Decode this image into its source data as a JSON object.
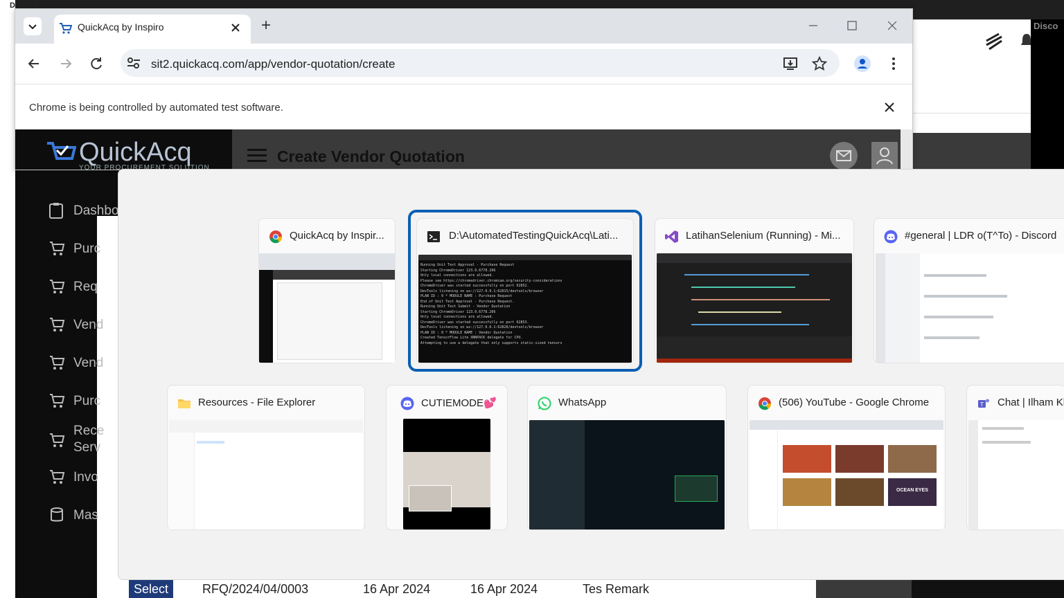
{
  "background": {
    "discord_label": "Discord",
    "right_window_label": "Disco"
  },
  "browser": {
    "tab_title": "QuickAcq by Inspiro",
    "new_tab_label": "+",
    "url": "sit2.quickacq.com/app/vendor-quotation/create",
    "infobar_text": "Chrome is being controlled by automated test software."
  },
  "app": {
    "logo_text": "QuickAcq",
    "logo_tagline": "YOUR PROCUREMENT SOLUTION",
    "page_title": "Create Vendor Quotation",
    "sidebar": [
      {
        "label": "Dashbo"
      },
      {
        "label": "Purc"
      },
      {
        "label": "Req"
      },
      {
        "label": "Vend"
      },
      {
        "label": "Vend"
      },
      {
        "label": "Purc"
      },
      {
        "label": "Rece"
      },
      {
        "label": "Serv"
      },
      {
        "label": "Invo"
      },
      {
        "label": "Mas"
      }
    ],
    "table_row": {
      "select_label": "Select",
      "rfq_no": "RFQ/2024/04/0003",
      "date1": "16 Apr 2024",
      "date2": "16 Apr 2024",
      "remark": "Tes Remark"
    }
  },
  "switcher": {
    "row1": [
      {
        "title": "QuickAcq by Inspir...",
        "icon": "chrome-icon"
      },
      {
        "title": "D:\\AutomatedTestingQuickAcq\\Lati...",
        "icon": "terminal-icon"
      },
      {
        "title": "LatihanSelenium (Running) - Mi...",
        "icon": "visual-studio-icon"
      },
      {
        "title": "#general | LDR o(T^To) - Discord",
        "icon": "discord-icon"
      }
    ],
    "row2": [
      {
        "title": "Resources - File Explorer",
        "icon": "folder-icon"
      },
      {
        "title": "CUTIEMODE💕",
        "icon": "discord-icon"
      },
      {
        "title": "WhatsApp",
        "icon": "whatsapp-icon"
      },
      {
        "title": "(506) YouTube - Google Chrome",
        "icon": "chrome-icon"
      },
      {
        "title": "Chat | Ilham Kh",
        "icon": "teams-icon"
      }
    ],
    "terminal_lines": [
      "Running Unit Test Approval - Purchase Request",
      "Starting ChromeDriver 123.0.6778.266",
      "Only local connections are allowed.",
      "Please see https://chromedriver.chromium.org/security-considerations",
      "ChromeDriver was started successfully on port 62852.",
      "DevTools listening on ws://127.0.0.1:62815/devtools/browser",
      "PLAN ID : 0 * MODULE NAME : Purchase Request",
      "End of Unit Test Approval - Purchase Request.",
      "Running Unit Test Submit - Vendor Quotation",
      "Starting ChromeDriver 123.0.6778.266",
      "Only local connections are allowed.",
      "ChromeDriver was started successfully on port 62853.",
      "DevTools listening on ws://127.0.0.1:62828/devtools/browser",
      "PLAN ID : 0 * MODULE NAME : Vendor Quotation",
      "Created TensorFlow Lite XNNPACK delegate for CPU.",
      "Attempting to use a delegate that only supports static-sized tensors"
    ],
    "youtube_thumb_label": "OCEAN EYES"
  },
  "colors": {
    "focus_ring": "#0a5fb4",
    "app_sidebar": "#0d0d0d",
    "select_button": "#1e3a78"
  }
}
